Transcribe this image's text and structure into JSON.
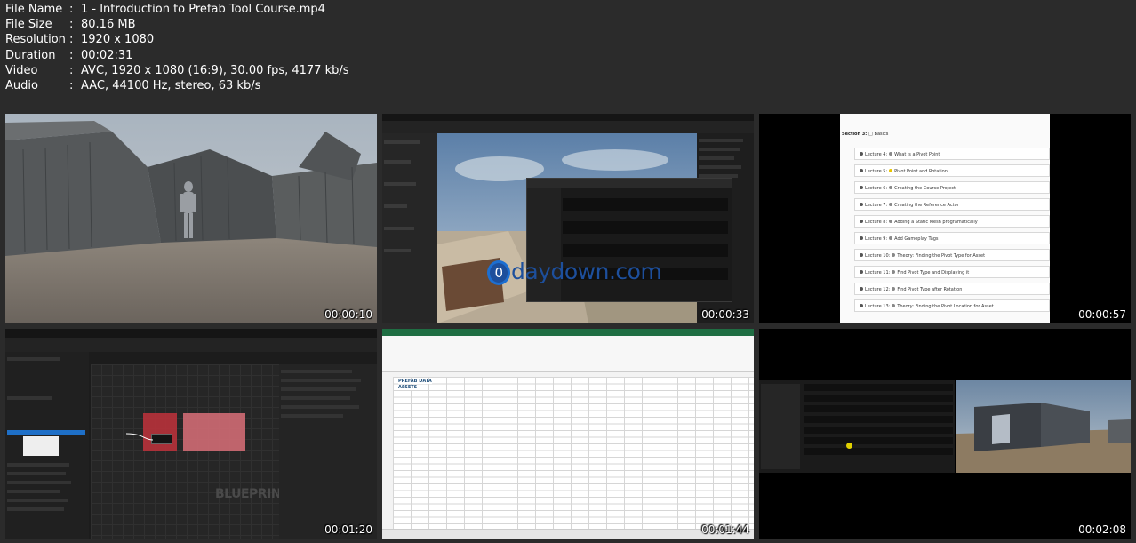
{
  "file_info": [
    {
      "key": "File Name",
      "value": "1 - Introduction to Prefab Tool Course.mp4"
    },
    {
      "key": "File Size",
      "value": "80.16 MB"
    },
    {
      "key": "Resolution",
      "value": "1920 x 1080"
    },
    {
      "key": "Duration",
      "value": "00:02:31"
    },
    {
      "key": "Video",
      "value": "AVC, 1920 x 1080 (16:9), 30.00 fps, 4177 kb/s"
    },
    {
      "key": "Audio",
      "value": "AAC, 44100 Hz, stereo, 63 kb/s"
    }
  ],
  "separator": ":",
  "thumbnails": [
    {
      "timestamp": "00:00:10"
    },
    {
      "timestamp": "00:00:33",
      "watermark": "daydown.com",
      "watermark_letter": "0"
    },
    {
      "timestamp": "00:00:57",
      "section": "Section 3:",
      "section_name": "Basics",
      "lectures": [
        {
          "num": "Lecture 4:",
          "title": "What is a Pivot Point"
        },
        {
          "num": "Lecture 5:",
          "title": "Pivot Point and Rotation"
        },
        {
          "num": "Lecture 6:",
          "title": "Creating the Course Project"
        },
        {
          "num": "Lecture 7:",
          "title": "Creating the Reference Actor"
        },
        {
          "num": "Lecture 8:",
          "title": "Adding a Static Mesh programatically"
        },
        {
          "num": "Lecture 9:",
          "title": "Add Gameplay Tags"
        },
        {
          "num": "Lecture 10:",
          "title": "Theory: Finding the Pivot Type for Asset"
        },
        {
          "num": "Lecture 11:",
          "title": "Find Pivot Type and Displaying it"
        },
        {
          "num": "Lecture 12:",
          "title": "Find Pivot Type after Rotation"
        },
        {
          "num": "Lecture 13:",
          "title": "Theory: Finding the Pivot Location for Asset"
        }
      ]
    },
    {
      "timestamp": "00:01:20",
      "watermark": "BLUEPRINT"
    },
    {
      "timestamp": "00:01:44",
      "sheet_title": "PREFAB DATA",
      "sheet_subtitle": "ASSETS"
    },
    {
      "timestamp": "00:02:08"
    }
  ]
}
